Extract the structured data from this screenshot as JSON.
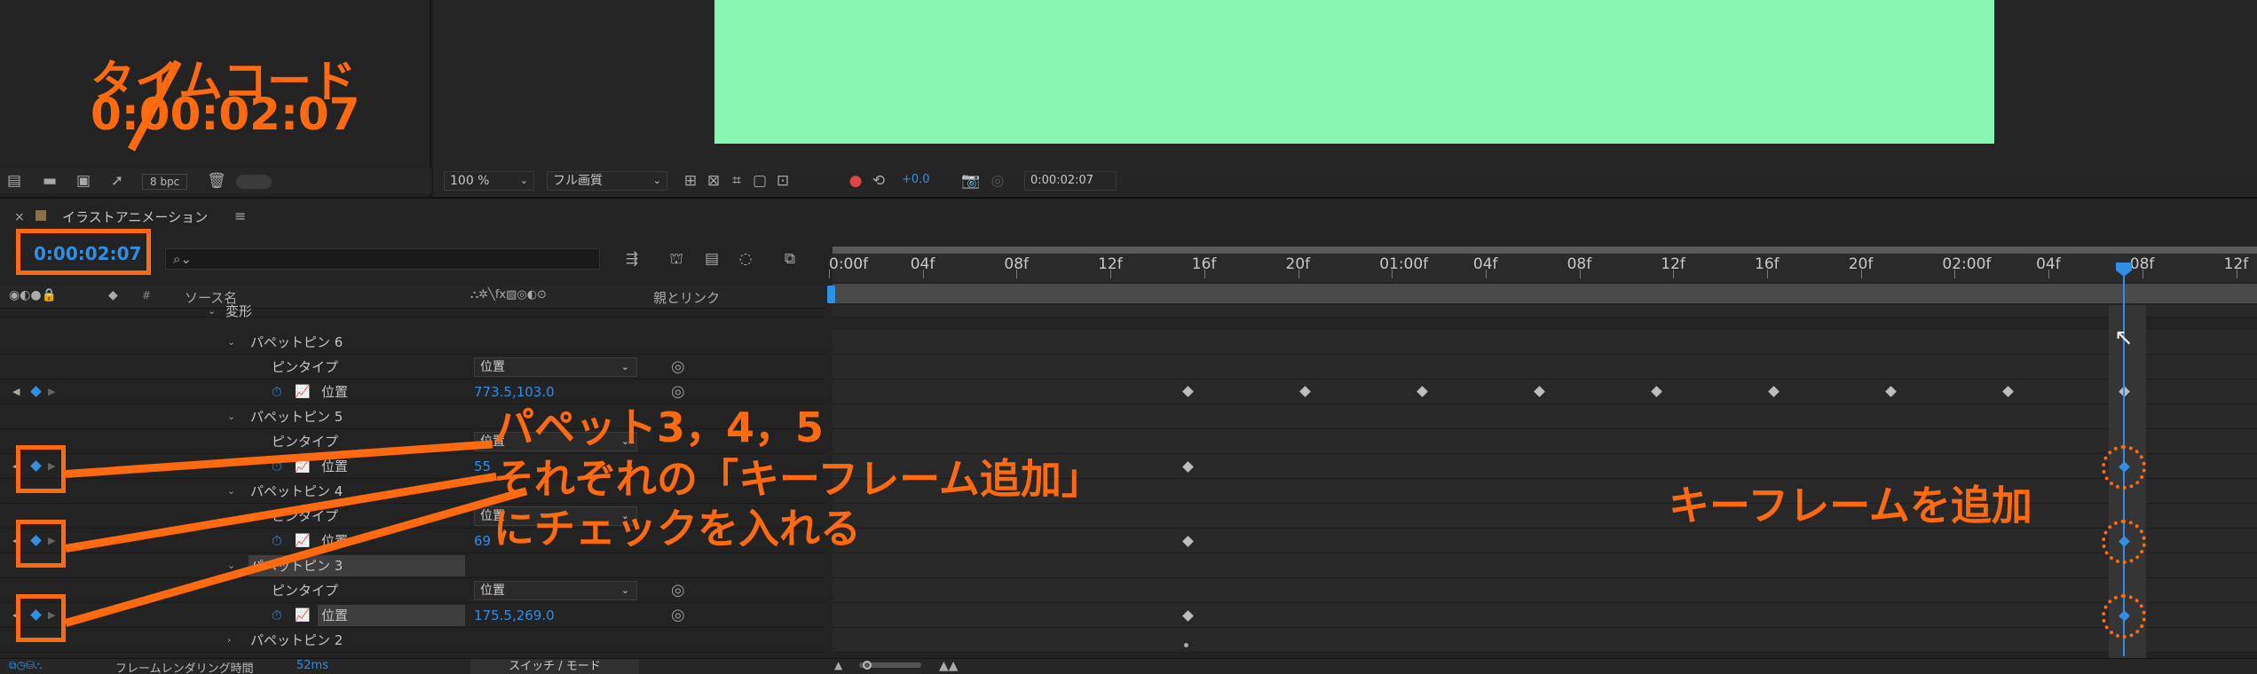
{
  "project": {
    "bpc_label": "8 bpc"
  },
  "viewer": {
    "zoom": "100 %",
    "quality": "フル画質",
    "exposure": "+0.0",
    "timecode": "0:00:02:07"
  },
  "comp": {
    "tab_title": "イラストアニメーション",
    "timecode": "0:00:02:07",
    "search_placeholder": ""
  },
  "columns": {
    "source_name": "ソース名",
    "parent_link": "親とリンク"
  },
  "ruler": {
    "labels": [
      "0:00f",
      "04f",
      "08f",
      "12f",
      "16f",
      "20f",
      "01:00f",
      "04f",
      "08f",
      "12f",
      "16f",
      "20f",
      "02:00f",
      "04f",
      "08f",
      "12f"
    ]
  },
  "layers": {
    "transform": "変形",
    "puppet6": "パペットピン 6",
    "puppet5": "パペットピン 5",
    "puppet4": "パペットピン 4",
    "puppet3": "パペットピン 3",
    "puppet2": "パペットピン 2",
    "pin_type": "ピンタイプ",
    "position_label": "位置",
    "pin_type_value": "位置",
    "pos6": "773.5,103.0",
    "pos5": "55",
    "pos4": "69",
    "pos3": "175.5,269.0"
  },
  "footer": {
    "render_time_label": "フレームレンダリング時間",
    "render_time_value": "52ms",
    "switch_mode": "スイッチ / モード"
  },
  "annotations": {
    "timecode_title": "タイムコード",
    "timecode_value": "0:00:02:07",
    "line1": "パペット3，4，5",
    "line2": "それぞれの「キーフレーム追加」",
    "line3": "にチェックを入れる",
    "right_label": "キーフレームを追加"
  },
  "colors": {
    "accent": "#ff6a10",
    "comp_bg": "#88f5b0",
    "value_blue": "#2e8fe6",
    "work_area_green": "#2bbb3a"
  }
}
